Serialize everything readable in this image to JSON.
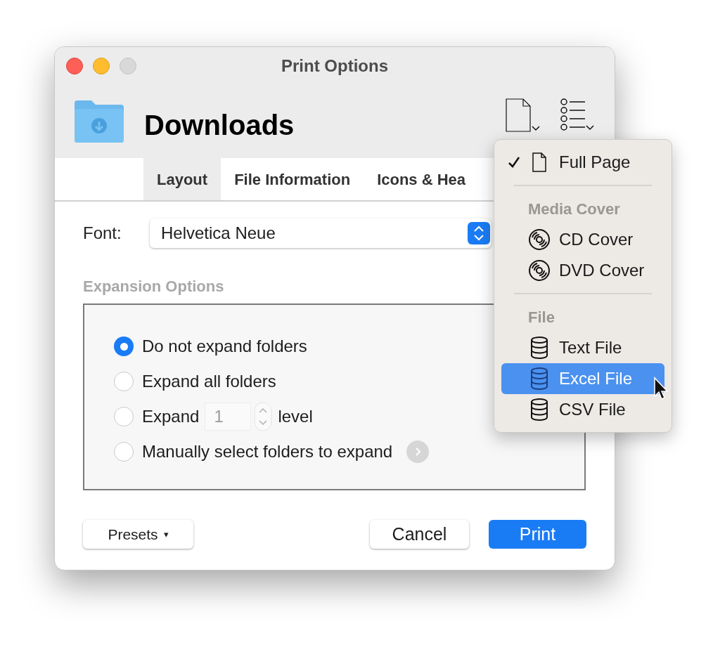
{
  "window": {
    "title": "Print Options"
  },
  "header": {
    "folder": "Downloads",
    "tools": [
      {
        "kind": "format"
      },
      {
        "kind": "style"
      }
    ]
  },
  "tabs": [
    {
      "label": "Layout",
      "selected": true
    },
    {
      "label": "File Information",
      "selected": false
    },
    {
      "label": "Icons & Hea",
      "selected": false
    }
  ],
  "font": {
    "label": "Font:",
    "value": "Helvetica Neue"
  },
  "expansion": {
    "title": "Expansion Options",
    "options": [
      {
        "kind": "plain",
        "label": "Do not expand folders",
        "selected": true
      },
      {
        "kind": "plain",
        "label": "Expand all folders",
        "selected": false
      },
      {
        "kind": "stepper",
        "label": "Expand",
        "value": "1",
        "suffix": "level",
        "selected": false
      },
      {
        "kind": "disclosure",
        "label": "Manually select folders to expand",
        "selected": false
      }
    ]
  },
  "buttons": {
    "presets": {
      "label": "Presets",
      "caret": "▾"
    },
    "cancel": "Cancel",
    "print": "Print"
  },
  "menu": {
    "items": [
      {
        "kind": "page",
        "label": "Full Page",
        "checked": true,
        "selected": false
      },
      {
        "kind": "separator"
      },
      {
        "kind": "header",
        "label": "Media Cover"
      },
      {
        "kind": "disc",
        "label": "CD Cover",
        "checked": false,
        "selected": false
      },
      {
        "kind": "disc",
        "label": "DVD Cover",
        "checked": false,
        "selected": false
      },
      {
        "kind": "separator"
      },
      {
        "kind": "header",
        "label": "File"
      },
      {
        "kind": "database",
        "label": "Text File",
        "checked": false,
        "selected": false
      },
      {
        "kind": "database",
        "label": "Excel File",
        "checked": false,
        "selected": true
      },
      {
        "kind": "database",
        "label": "CSV File",
        "checked": false,
        "selected": false
      }
    ]
  }
}
